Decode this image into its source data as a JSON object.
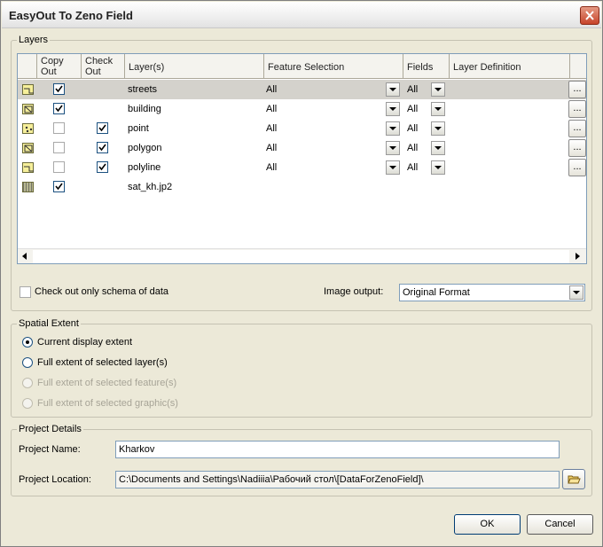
{
  "window": {
    "title": "EasyOut To Zeno Field"
  },
  "layers": {
    "legend": "Layers",
    "columns": {
      "copy_out": "Copy Out",
      "check_out": "Check Out",
      "layer": "Layer(s)",
      "feature_selection": "Feature Selection",
      "fields": "Fields",
      "layer_definition": "Layer Definition"
    },
    "rows": [
      {
        "icon": "line-layer-icon",
        "copy_out": true,
        "check_out": null,
        "name": "streets",
        "feature_selection": "All",
        "fields": "All",
        "selected": true
      },
      {
        "icon": "polygon-layer-icon",
        "copy_out": true,
        "check_out": null,
        "name": "building",
        "feature_selection": "All",
        "fields": "All",
        "selected": false
      },
      {
        "icon": "point-layer-icon",
        "copy_out": false,
        "check_out": true,
        "name": "point",
        "feature_selection": "All",
        "fields": "All",
        "selected": false
      },
      {
        "icon": "polygon-layer-icon",
        "copy_out": false,
        "check_out": true,
        "name": "polygon",
        "feature_selection": "All",
        "fields": "All",
        "selected": false
      },
      {
        "icon": "line-layer-icon",
        "copy_out": false,
        "check_out": true,
        "name": "polyline",
        "feature_selection": "All",
        "fields": "All",
        "selected": false
      },
      {
        "icon": "raster-layer-icon",
        "copy_out": true,
        "check_out": null,
        "name": "sat_kh.jp2",
        "feature_selection": null,
        "fields": null,
        "selected": false
      }
    ],
    "layer_definition_button": "...",
    "schema_only_label": "Check out only schema of data",
    "schema_only_checked": false,
    "image_output_label": "Image output:",
    "image_output_value": "Original Format"
  },
  "spatial_extent": {
    "legend": "Spatial Extent",
    "options": [
      {
        "label": "Current display extent",
        "selected": true,
        "enabled": true
      },
      {
        "label": "Full extent of selected layer(s)",
        "selected": false,
        "enabled": true
      },
      {
        "label": "Full extent of selected feature(s)",
        "selected": false,
        "enabled": false
      },
      {
        "label": "Full extent of selected graphic(s)",
        "selected": false,
        "enabled": false
      }
    ]
  },
  "project": {
    "legend": "Project Details",
    "name_label": "Project Name:",
    "name_value": "Kharkov",
    "location_label": "Project Location:",
    "location_value": "C:\\Documents and Settings\\Nadiiia\\Рабочий стол\\[DataForZenoField]\\"
  },
  "buttons": {
    "ok": "OK",
    "cancel": "Cancel"
  },
  "colors": {
    "selected_row": "#d4d2cc",
    "dialog_bg": "#ECE9D8",
    "close_button": "#c7442a"
  }
}
